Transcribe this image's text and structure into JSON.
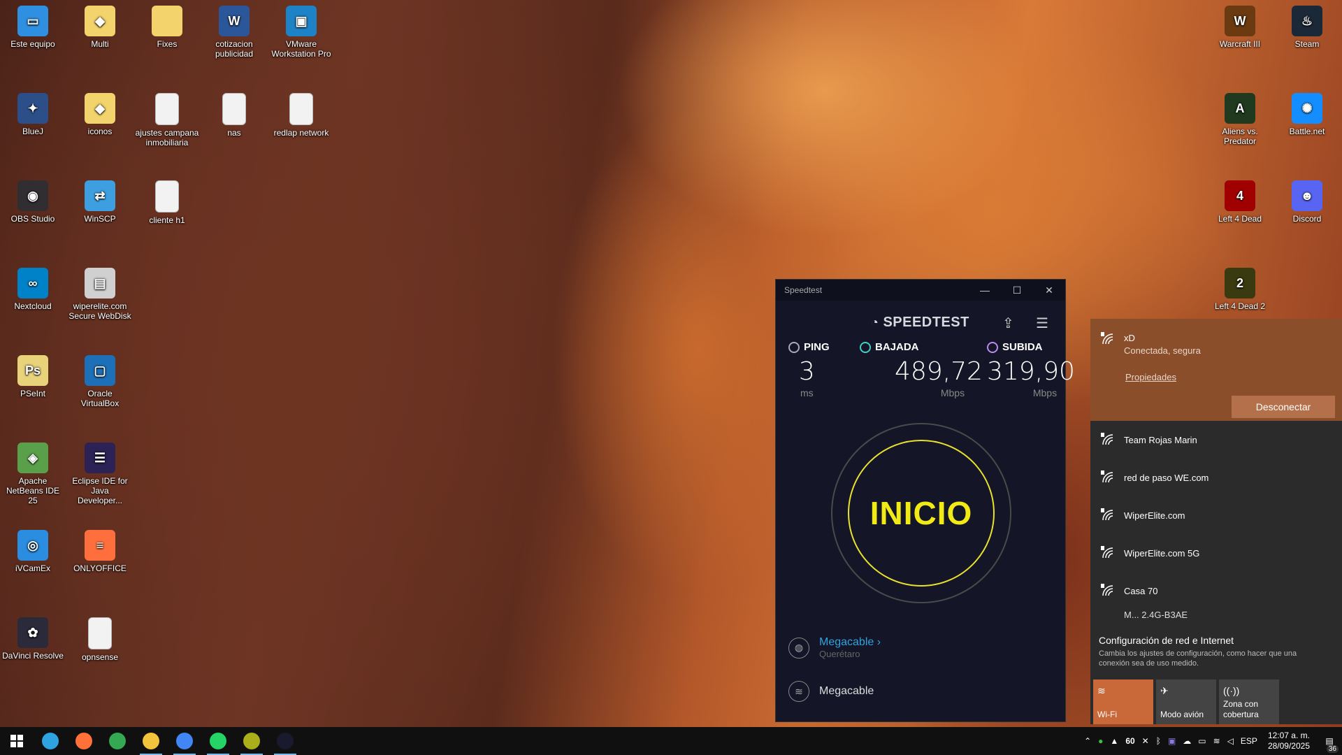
{
  "desktop": {
    "left_icons": [
      {
        "label": "Este equipo",
        "color": "#2f8fe0",
        "glyph": "▭"
      },
      {
        "label": "Multi",
        "color": "#f3d36b",
        "glyph": "◆"
      },
      {
        "label": "Fixes",
        "color": "#f3d36b",
        "glyph": ""
      },
      {
        "label": "cotizacion publicidad",
        "color": "#2b579a",
        "glyph": "W"
      },
      {
        "label": "VMware Workstation Pro",
        "color": "#1d83c6",
        "glyph": "▣"
      },
      {
        "label": "BlueJ",
        "color": "#2c4f8a",
        "glyph": "✦"
      },
      {
        "label": "iconos",
        "color": "#f3d36b",
        "glyph": "◆"
      },
      {
        "label": "ajustes campana inmobiliaria",
        "color": "#f2f2f2",
        "glyph": ""
      },
      {
        "label": "nas",
        "color": "#f2f2f2",
        "glyph": ""
      },
      {
        "label": "redlap network",
        "color": "#f2f2f2",
        "glyph": ""
      },
      {
        "label": "OBS Studio",
        "color": "#302e31",
        "glyph": "◉"
      },
      {
        "label": "WinSCP",
        "color": "#3e9fe0",
        "glyph": "⇄"
      },
      {
        "label": "cliente h1",
        "color": "#f2f2f2",
        "glyph": ""
      },
      {
        "label": "Nextcloud",
        "color": "#0082c9",
        "glyph": "∞"
      },
      {
        "label": "wiperelite.com Secure WebDisk",
        "color": "#d0d0d0",
        "glyph": "▤"
      },
      {
        "label": "PSeInt",
        "color": "#e8d27a",
        "glyph": "Ps"
      },
      {
        "label": "Oracle VirtualBox",
        "color": "#1d6fb8",
        "glyph": "▢"
      },
      {
        "label": "Apache NetBeans IDE 25",
        "color": "#5aa04a",
        "glyph": "◈"
      },
      {
        "label": "Eclipse IDE for Java Developer...",
        "color": "#2c2255",
        "glyph": "☰"
      },
      {
        "label": "iVCamEx",
        "color": "#2b8de0",
        "glyph": "◎"
      },
      {
        "label": "ONLYOFFICE",
        "color": "#ff6f3d",
        "glyph": "≡"
      },
      {
        "label": "DaVinci Resolve",
        "color": "#2a2a3a",
        "glyph": "✿"
      },
      {
        "label": "opnsense",
        "color": "#f2f2f2",
        "glyph": ""
      }
    ],
    "right_icons": [
      {
        "label": "Warcraft III",
        "color": "#6b3a10",
        "glyph": "W"
      },
      {
        "label": "Steam",
        "color": "#1b2838",
        "glyph": "♨"
      },
      {
        "label": "Aliens vs. Predator",
        "color": "#1f3a1f",
        "glyph": "A"
      },
      {
        "label": "Battle.net",
        "color": "#148eff",
        "glyph": "✺"
      },
      {
        "label": "Left 4 Dead",
        "color": "#a00000",
        "glyph": "4"
      },
      {
        "label": "Discord",
        "color": "#5865f2",
        "glyph": "☻"
      },
      {
        "label": "Left 4 Dead 2",
        "color": "#3a3a10",
        "glyph": "2"
      }
    ]
  },
  "speedtest": {
    "window_title": "Speedtest",
    "logo": "SPEEDTEST",
    "ping": {
      "label": "PING",
      "value": "3",
      "unit": "ms",
      "color": "#aab"
    },
    "download": {
      "label": "BAJADA",
      "value": "489,72",
      "unit": "Mbps",
      "color": "#3fd0c8"
    },
    "upload": {
      "label": "SUBIDA",
      "value": "319,90",
      "unit": "Mbps",
      "color": "#b88cf0"
    },
    "go_label": "INICIO",
    "isp_name": "Megacable",
    "isp_location": "Querétaro",
    "network_name": "Megacable"
  },
  "network": {
    "connected": {
      "ssid": "xD",
      "status": "Conectada, segura",
      "properties": "Propiedades",
      "disconnect": "Desconectar"
    },
    "list": [
      "Team Rojas Marin",
      "red de paso WE.com",
      "WiperElite.com",
      "WiperElite.com 5G",
      "Casa 70"
    ],
    "partial_item": "M... 2.4G-B3AE",
    "settings_title": "Configuración de red e Internet",
    "settings_desc": "Cambia los ajustes de configuración, como hacer que una conexión sea de uso medido.",
    "quick_actions": [
      {
        "label": "Wi-Fi",
        "icon": "wifi-icon",
        "active": true
      },
      {
        "label": "Modo avión",
        "icon": "airplane-icon",
        "active": false
      },
      {
        "label": "Zona con cobertura",
        "icon": "hotspot-icon",
        "active": false
      }
    ]
  },
  "taskbar": {
    "apps": [
      {
        "name": "edge",
        "color": "#2fa3e0"
      },
      {
        "name": "firefox",
        "color": "#ff7139"
      },
      {
        "name": "chrome",
        "color": "#34a853"
      },
      {
        "name": "file-explorer",
        "color": "#f3c33b"
      },
      {
        "name": "chrome-profile",
        "color": "#4285f4"
      },
      {
        "name": "whatsapp",
        "color": "#25d366"
      },
      {
        "name": "fireworks",
        "color": "#a9b01a"
      },
      {
        "name": "speedtest",
        "color": "#1a1a2e"
      }
    ],
    "tray": {
      "temperature": "60",
      "language": "ESP",
      "time": "12:07 a. m.",
      "date": "28/09/2025",
      "notifications": "36"
    }
  }
}
